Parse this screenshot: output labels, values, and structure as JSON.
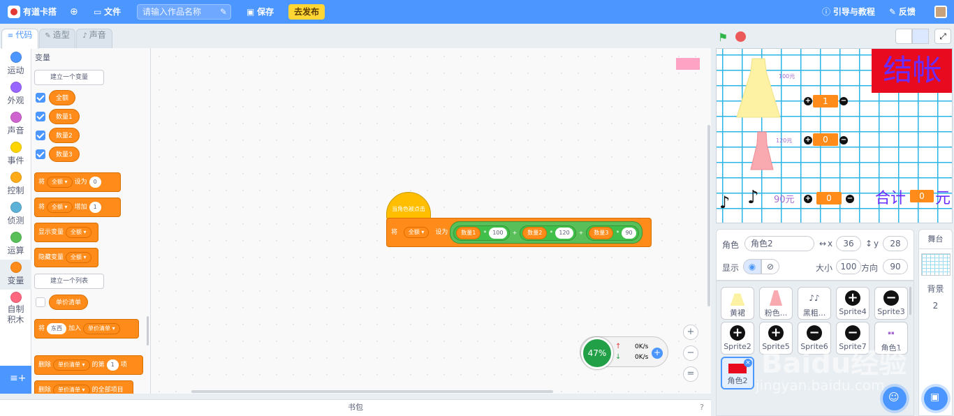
{
  "topbar": {
    "brand": "有道卡搭",
    "file_menu": "文件",
    "project_name_placeholder": "请输入作品名称",
    "save_label": "保存",
    "publish_label": "去发布",
    "tutorial_label": "引导与教程",
    "feedback_label": "反馈"
  },
  "tabs": [
    {
      "label": "代码"
    },
    {
      "label": "造型"
    },
    {
      "label": "声音"
    }
  ],
  "categories": [
    {
      "label": "运动",
      "color": "#4c97ff"
    },
    {
      "label": "外观",
      "color": "#9966ff"
    },
    {
      "label": "声音",
      "color": "#cf63cf"
    },
    {
      "label": "事件",
      "color": "#ffd500"
    },
    {
      "label": "控制",
      "color": "#ffab19"
    },
    {
      "label": "侦测",
      "color": "#5cb1d6"
    },
    {
      "label": "运算",
      "color": "#59c059"
    },
    {
      "label": "变量",
      "color": "#ff8c1a"
    },
    {
      "label": "自制积木",
      "color": "#ff6680"
    }
  ],
  "palette": {
    "section_title": "变量",
    "make_variable": "建立一个变量",
    "variables": [
      "全额",
      "数量1",
      "数量2",
      "数量3"
    ],
    "set_block": {
      "prefix": "将",
      "var": "全额",
      "mid": "设为",
      "value": "0"
    },
    "change_block": {
      "prefix": "将",
      "var": "全额",
      "mid": "增加",
      "value": "1"
    },
    "show_block": {
      "prefix": "显示变量",
      "var": "全额"
    },
    "hide_block": {
      "prefix": "隐藏变量",
      "var": "全额"
    },
    "make_list": "建立一个列表",
    "list_name": "单价清单",
    "add_block": {
      "prefix": "将",
      "item": "东西",
      "mid": "加入",
      "list": "单价清单"
    },
    "delete_block": {
      "prefix": "删除",
      "list": "单价清单",
      "mid": "的第",
      "value": "1",
      "suffix": "项"
    },
    "delete_all_block": {
      "prefix": "删除",
      "list": "单价清单",
      "suffix": "的全部项目"
    }
  },
  "script": {
    "hat_label": "当角色被点击",
    "set_prefix": "将",
    "set_var": "全额",
    "set_mid": "设为",
    "terms": [
      {
        "var": "数量1",
        "op": "*",
        "value": "100"
      },
      {
        "var": "数量2",
        "op": "*",
        "value": "120"
      },
      {
        "var": "数量3",
        "op": "*",
        "value": "90"
      }
    ],
    "plus": "+"
  },
  "speed_widget": {
    "percent": "47%",
    "up": "0K/s",
    "down": "0K/s"
  },
  "bookbag_label": "书包",
  "stage": {
    "checkout_label": "结帐",
    "price1": "100元",
    "price2": "120元",
    "price3": "90元",
    "qty1": "1",
    "qty2": "0",
    "qty3": "0",
    "total_label": "合计",
    "total_value": "0",
    "total_unit": "元"
  },
  "sprite_info": {
    "sprite_label": "角色",
    "sprite_name": "角色2",
    "x_label": "x",
    "x_value": "36",
    "y_label": "y",
    "y_value": "28",
    "show_label": "显示",
    "size_label": "大小",
    "size_value": "100",
    "direction_label": "方向",
    "direction_value": "90"
  },
  "sprites": [
    {
      "name": "黄裙",
      "icon": "yellow-dress-icon"
    },
    {
      "name": "粉色...",
      "icon": "pink-dress-icon"
    },
    {
      "name": "黑粗...",
      "icon": "black-notes-icon"
    },
    {
      "name": "Sprite4",
      "icon": "plus-circle-icon"
    },
    {
      "name": "Sprite3",
      "icon": "minus-circle-icon"
    },
    {
      "name": "Sprite2",
      "icon": "plus-circle-icon"
    },
    {
      "name": "Sprite5",
      "icon": "plus-circle-icon"
    },
    {
      "name": "Sprite6",
      "icon": "minus-circle-icon"
    },
    {
      "name": "Sprite7",
      "icon": "minus-circle-icon"
    },
    {
      "name": "角色1",
      "icon": "small-text-icon"
    },
    {
      "name": "角色2",
      "icon": "red-banner-icon"
    }
  ],
  "stage_panel": {
    "label": "舞台",
    "backdrop_label": "背景",
    "backdrop_count": "2"
  },
  "watermark": {
    "text": "Baidu经验",
    "url": "jingyan.baidu.com"
  }
}
